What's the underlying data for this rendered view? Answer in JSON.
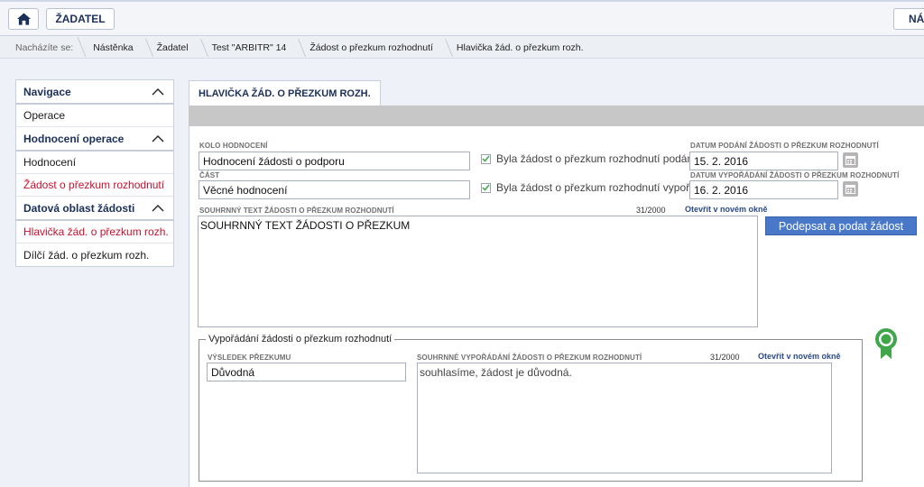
{
  "topbar": {
    "home_icon": "home-icon",
    "user_label": "ŽADATEL",
    "right_label": "NÁR"
  },
  "breadcrumb": {
    "lead": "Nacházíte se:",
    "items": [
      "Nástěnka",
      "Žadatel",
      "Test \"ARBITR\" 14",
      "Žádost o přezkum rozhodnutí",
      "Hlavička žád. o přezkum rozh."
    ]
  },
  "sidebar": {
    "sections": [
      {
        "title": "Navigace",
        "items": [
          {
            "label": "Operace",
            "active": false
          }
        ]
      },
      {
        "title": "Hodnocení operace",
        "items": [
          {
            "label": "Hodnocení",
            "active": false
          },
          {
            "label": "Žádost o přezkum rozhodnutí",
            "active": true
          }
        ]
      },
      {
        "title": "Datová oblast žádosti",
        "items": [
          {
            "label": "Hlavička žád. o přezkum rozh.",
            "active": true
          },
          {
            "label": "Dílčí žád. o přezkum rozh.",
            "active": false
          }
        ]
      }
    ]
  },
  "main": {
    "tab_label": "HLAVIČKA ŽÁD. O PŘEZKUM ROZH.",
    "kolo_label": "KOLO HODNOCENÍ",
    "kolo_value": "Hodnocení žádosti o podporu",
    "cast_label": "ČÁST",
    "cast_value": "Věcné hodnocení",
    "cb1_label": "Byla žádost o přezkum rozhodnutí podána?",
    "cb2_label": "Byla žádost o přezkum rozhodnutí vypořádána?",
    "datum_podani_label": "DATUM PODÁNÍ ŽÁDOSTI O PŘEZKUM ROZHODNUTÍ",
    "datum_podani_value": "15. 2. 2016",
    "datum_vyporadani_label": "DATUM VYPOŘÁDÁNÍ ŽÁDOSTI O PŘEZKUM ROZHODNUTÍ",
    "datum_vyporadani_value": "16. 2. 2016",
    "souhrnny_label": "SOUHRNNÝ TEXT ŽÁDOSTI O PŘEZKUM ROZHODNUTÍ",
    "souhrnny_counter": "31/2000",
    "souhrnny_link": "Otevřít v novém okně",
    "souhrnny_value": "SOUHRNNÝ TEXT ŽÁDOSTI O PŘEZKUM",
    "sign_button": "Podepsat a podat žádost",
    "fieldset_legend": "Vypořádání žádosti o přezkum rozhodnutí",
    "vysledek_label": "VÝSLEDEK PŘEZKUMU",
    "vysledek_value": "Důvodná",
    "souhrnne_vyp_label": "SOUHRNNÉ VYPOŘÁDÁNÍ ŽÁDOSTI O PŘEZKUM ROZHODNUTÍ",
    "souhrnne_vyp_counter": "31/2000",
    "souhrnne_vyp_link": "Otevřít v novém okně",
    "souhrnne_vyp_value": "souhlasíme, žádost je důvodná.",
    "badge_icon": "award-ribbon-icon"
  },
  "colors": {
    "accent_blue": "#4a78c9",
    "nav_title": "#1a2f5a",
    "active_red": "#c8102e",
    "badge_green": "#3fa64a"
  }
}
